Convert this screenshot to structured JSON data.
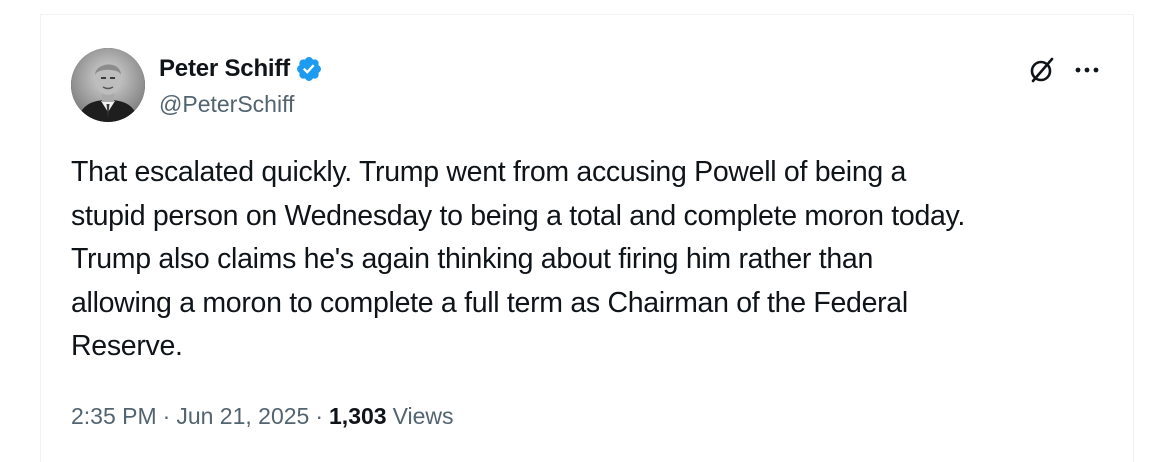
{
  "author": {
    "display_name": "Peter Schiff",
    "handle": "@PeterSchiff",
    "verified": true
  },
  "icons": {
    "verified": "verified-badge-icon",
    "grok": "grok-icon",
    "more": "more-options-icon"
  },
  "colors": {
    "verified_blue": "#1d9bf0",
    "text_primary": "#0f1419",
    "text_secondary": "#536471"
  },
  "tweet": {
    "text": "That escalated quickly. Trump went from accusing Powell of being a\nstupid person on Wednesday to being a total and complete moron today.\nTrump also claims he's again thinking about firing him rather than\nallowing a moron to complete a full term as Chairman of the Federal\nReserve."
  },
  "meta": {
    "time": "2:35 PM",
    "separator": "·",
    "date": "Jun 21, 2025",
    "views_count": "1,303",
    "views_label": "Views"
  }
}
